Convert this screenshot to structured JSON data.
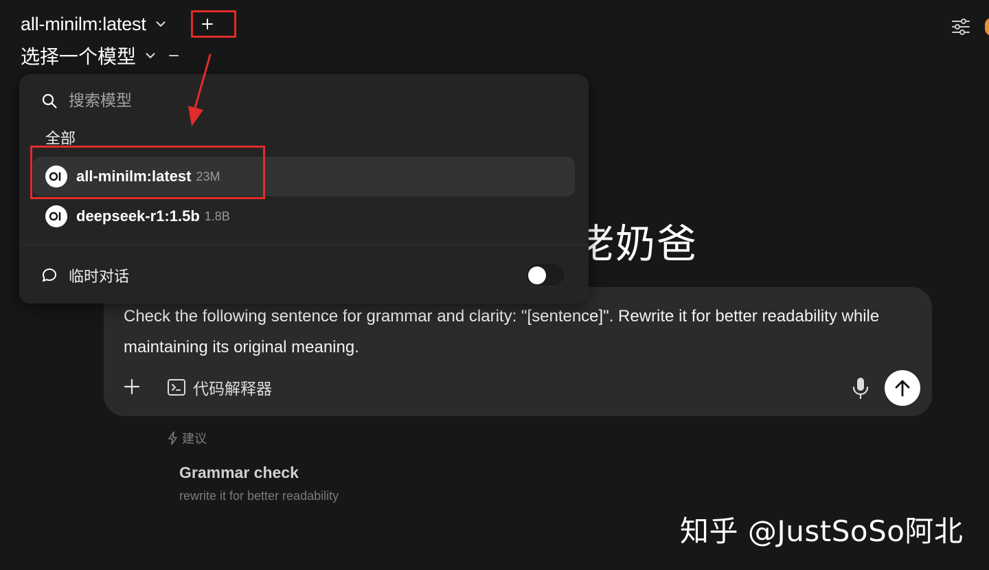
{
  "header": {
    "model_primary": "all-minilm:latest",
    "model_secondary": "选择一个模型",
    "add_label": "+"
  },
  "background_heading": "佬奶爸",
  "dropdown": {
    "search_placeholder": "搜索模型",
    "section_label": "全部",
    "models": [
      {
        "name": "all-minilm:latest",
        "size": "23M",
        "selected": true,
        "badge": "OI"
      },
      {
        "name": "deepseek-r1:1.5b",
        "size": "1.8B",
        "selected": false,
        "badge": "OI"
      }
    ],
    "temp_chat_label": "临时对话",
    "temp_chat_enabled": false
  },
  "prompt": {
    "text": "Check the following sentence for grammar and clarity: \"[sentence]\". Rewrite it for better readability while maintaining its original meaning.",
    "code_interpreter_label": "代码解释器"
  },
  "suggestions": {
    "header": "建议",
    "items": [
      {
        "title": "Grammar check",
        "subtitle": "rewrite it for better readability"
      }
    ]
  },
  "watermark": "知乎 @JustSoSo阿北",
  "colors": {
    "background": "#171717",
    "panel": "#242424",
    "card": "#2b2b2b",
    "annotation": "#e22b2b",
    "avatar": "#e8913a"
  }
}
